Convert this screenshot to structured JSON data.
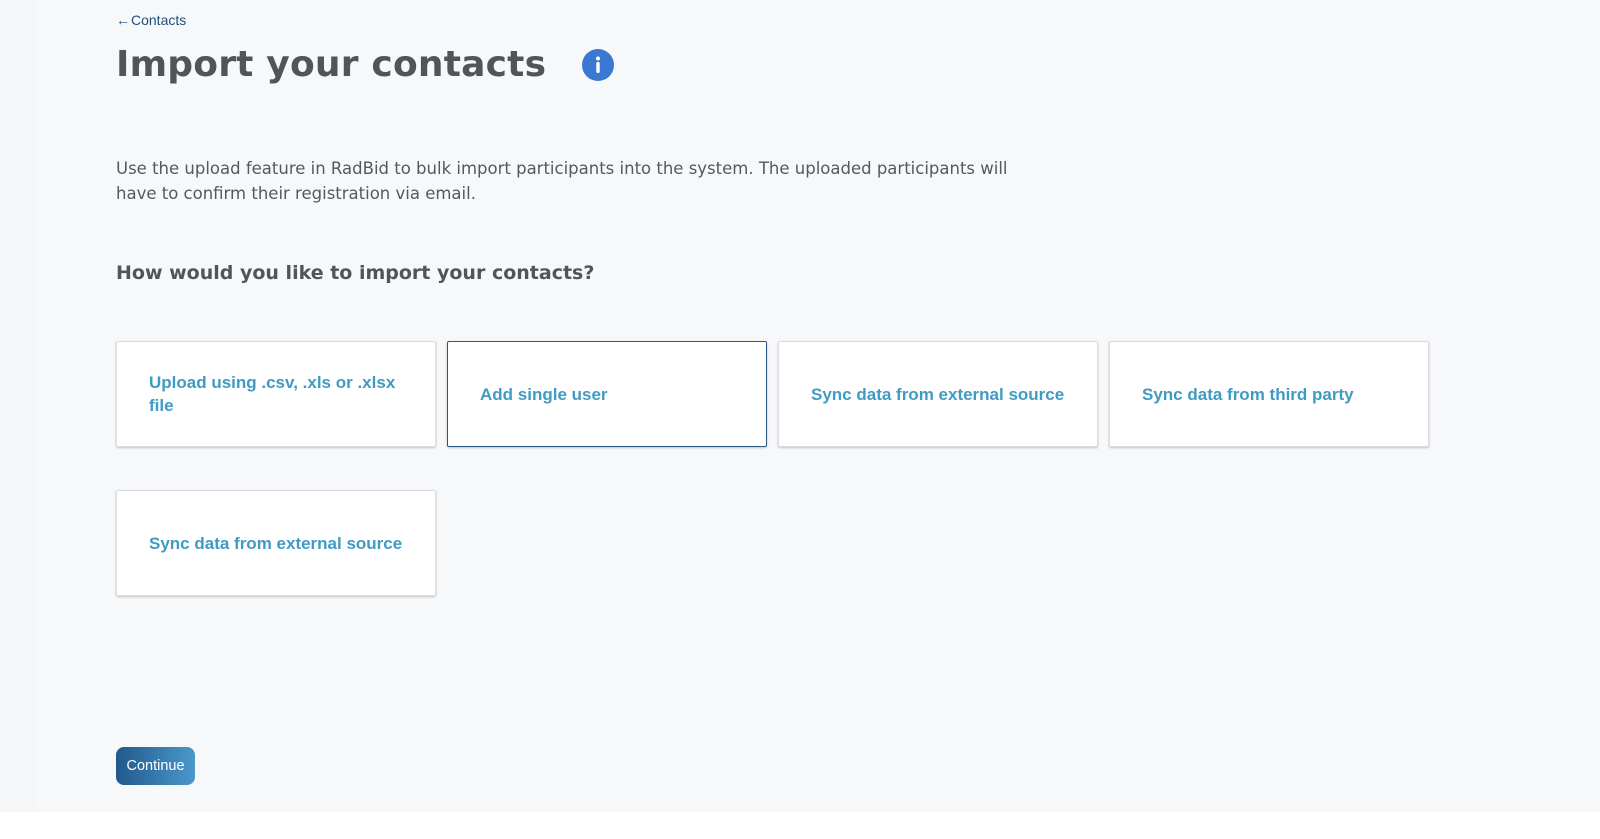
{
  "nav": {
    "back_arrow": "←",
    "back_label": "Contacts"
  },
  "header": {
    "title": "Import your contacts",
    "info_icon": "info-icon",
    "info_glyph": "i"
  },
  "main": {
    "description": "Use the upload feature in RadBid to bulk import participants into the system. The uploaded participants will have to confirm their registration via email.",
    "question": "How would you like to import your contacts?",
    "options": [
      {
        "label": "Upload using .csv, .xls or .xlsx file",
        "selected": false
      },
      {
        "label": "Add single user",
        "selected": true
      },
      {
        "label": "Sync data from external source",
        "selected": false
      },
      {
        "label": "Sync data from third party",
        "selected": false
      },
      {
        "label": "Sync data from external source",
        "selected": false
      }
    ]
  },
  "footer": {
    "continue_label": "Continue"
  },
  "colors": {
    "accent": "#3a78d3",
    "option_text": "#3f9bc4",
    "selected_border": "#2c5a85",
    "button_start": "#21598c",
    "button_end": "#4b98cb"
  }
}
